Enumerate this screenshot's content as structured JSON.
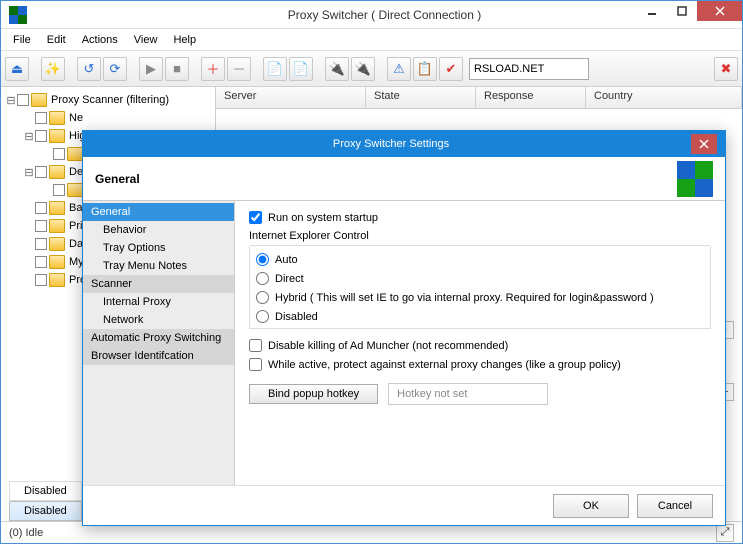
{
  "window": {
    "title": "Proxy Switcher  ( Direct Connection )"
  },
  "menu": {
    "file": "File",
    "edit": "Edit",
    "actions": "Actions",
    "view": "View",
    "help": "Help"
  },
  "toolbar": {
    "search_value": "RSLOAD.NET"
  },
  "tree": {
    "root": "Proxy Scanner (filtering)",
    "items": [
      {
        "label": "Ne",
        "depth": 1
      },
      {
        "label": "Hig",
        "depth": 1,
        "expandable": true
      },
      {
        "label": "",
        "depth": 2
      },
      {
        "label": "De",
        "depth": 1,
        "expandable": true
      },
      {
        "label": "",
        "depth": 2
      },
      {
        "label": "Ba",
        "depth": 1
      },
      {
        "label": "Pri",
        "depth": 1
      },
      {
        "label": "Da",
        "depth": 1
      },
      {
        "label": "My",
        "depth": 1
      },
      {
        "label": "Pro",
        "depth": 1
      }
    ]
  },
  "list_headers": {
    "server": "Server",
    "state": "State",
    "response": "Response",
    "country": "Country"
  },
  "bottom_tabs": {
    "disabled1": "Disabled",
    "disabled2": "Disabled"
  },
  "status": {
    "idle": "(0)  Idle"
  },
  "dialog": {
    "title": "Proxy Switcher Settings",
    "header": "General",
    "nav": [
      {
        "label": "General",
        "type": "selected"
      },
      {
        "label": "Behavior",
        "type": "sub"
      },
      {
        "label": "Tray Options",
        "type": "sub"
      },
      {
        "label": "Tray Menu Notes",
        "type": "sub"
      },
      {
        "label": "Scanner",
        "type": "head"
      },
      {
        "label": "Internal Proxy",
        "type": "sub"
      },
      {
        "label": "Network",
        "type": "sub"
      },
      {
        "label": "Automatic Proxy Switching",
        "type": "head"
      },
      {
        "label": "Browser Identifcation",
        "type": "head"
      }
    ],
    "general": {
      "run_startup": "Run on system startup",
      "ie_control_label": "Internet Explorer Control",
      "radio_auto": "Auto",
      "radio_direct": "Direct",
      "radio_hybrid": "Hybrid ( This will set IE to go via internal proxy. Required for login&password )",
      "radio_disabled": "Disabled",
      "chk_admuncher": "Disable killing of Ad Muncher (not recommended)",
      "chk_protect": "While active, protect against external proxy changes (like a group policy)",
      "bind_hotkey_btn": "Bind popup hotkey",
      "hotkey_placeholder": "Hotkey not set"
    },
    "buttons": {
      "ok": "OK",
      "cancel": "Cancel"
    }
  }
}
